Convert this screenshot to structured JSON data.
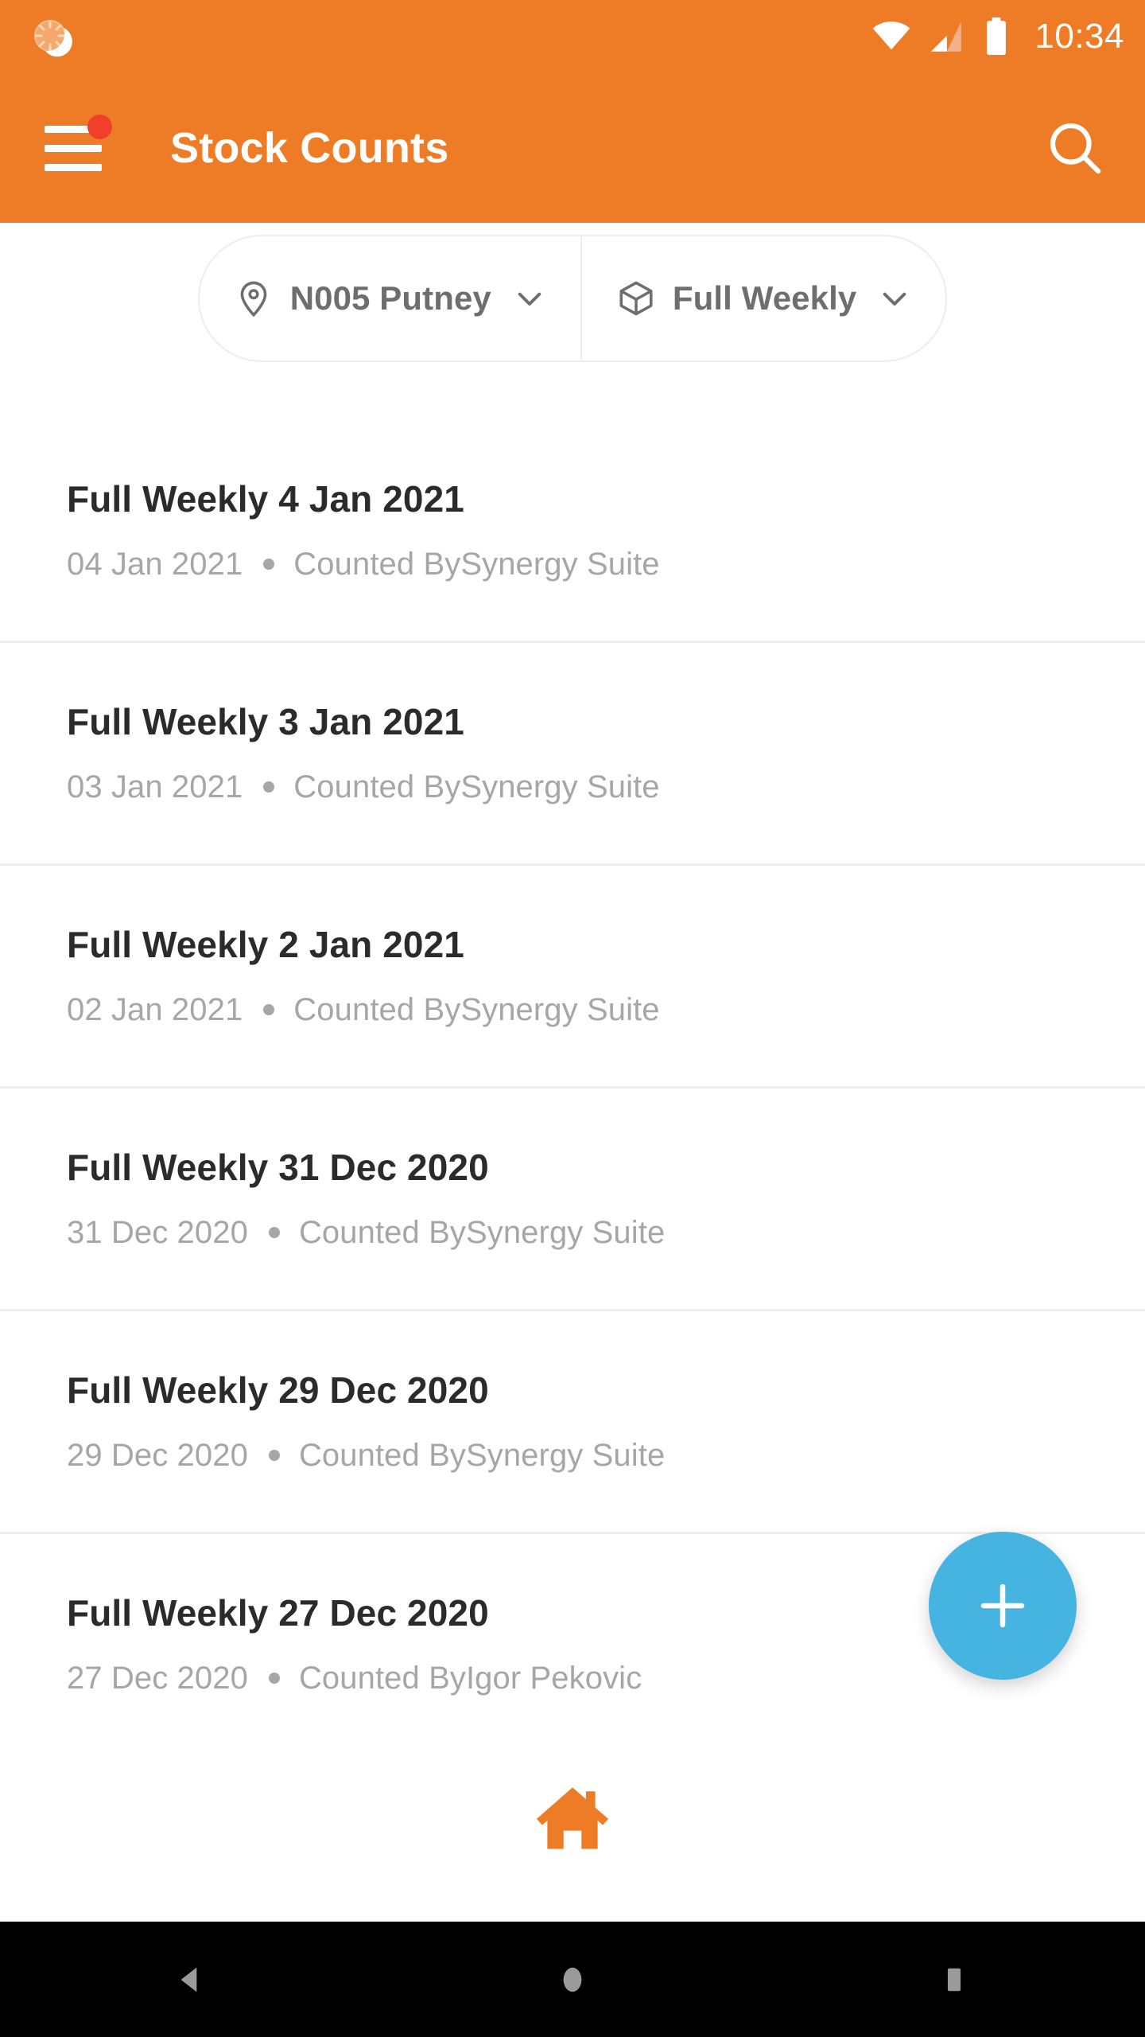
{
  "status_bar": {
    "time": "10:34",
    "icons": [
      "notification-sync-icon",
      "wifi-icon",
      "cellular-signal-icon",
      "battery-icon"
    ],
    "background_color": "#EE7C26"
  },
  "app_bar": {
    "title": "Stock Counts",
    "menu_icon": "hamburger-menu-icon",
    "menu_has_notification_dot": true,
    "notification_dot_color": "#F0402B",
    "search_icon": "search-icon",
    "background_color": "#EE7C26",
    "text_color": "#FFFFFF"
  },
  "filters": [
    {
      "icon": "location-pin-icon",
      "label": "N005 Putney",
      "chevron": "chevron-down-icon"
    },
    {
      "icon": "cube-box-icon",
      "label": "Full Weekly",
      "chevron": "chevron-down-icon"
    }
  ],
  "list": {
    "separator_dot": "•",
    "items": [
      {
        "title": "Full Weekly 4 Jan 2021",
        "date": "04 Jan 2021",
        "counted_by": "Counted BySynergy Suite"
      },
      {
        "title": "Full Weekly 3 Jan 2021",
        "date": "03 Jan 2021",
        "counted_by": "Counted BySynergy Suite"
      },
      {
        "title": "Full Weekly 2 Jan 2021",
        "date": "02 Jan 2021",
        "counted_by": "Counted BySynergy Suite"
      },
      {
        "title": "Full Weekly 31 Dec 2020",
        "date": "31 Dec 2020",
        "counted_by": "Counted BySynergy Suite"
      },
      {
        "title": "Full Weekly 29 Dec 2020",
        "date": "29 Dec 2020",
        "counted_by": "Counted BySynergy Suite"
      },
      {
        "title": "Full Weekly 27 Dec 2020",
        "date": "27 Dec 2020",
        "counted_by": "Counted ByIgor Pekovic"
      }
    ]
  },
  "fab": {
    "icon": "plus-icon",
    "color": "#45B4E0"
  },
  "home_indicator": {
    "icon": "home-icon",
    "color": "#EE7C26"
  },
  "android_nav": {
    "back_icon": "back-triangle-icon",
    "home_icon": "home-circle-icon",
    "recents_icon": "recents-square-icon",
    "background_color": "#000000"
  }
}
